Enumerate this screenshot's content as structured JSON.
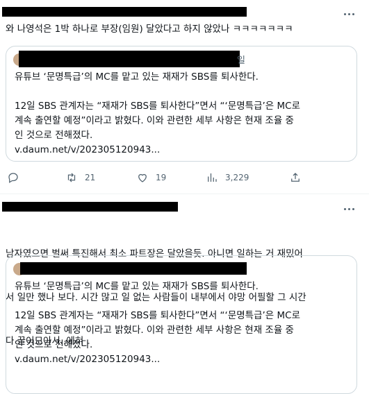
{
  "tweets": [
    {
      "text": "와 나영석은 1박 하나로 부장(임원) 달았다고 하지 않았나 ㅋㅋㅋㅋㅋㅋㅋ",
      "quote": {
        "name_suffix": "일",
        "headline": "유튜브 ‘문명특급’의 MC를 맡고 있는 재재가 SBS를 퇴사한다.",
        "body_lines": [
          "12일 SBS 관계자는 “재재가 SBS를 퇴사한다”면서 “‘문명특급’은 MC로",
          "계속 출연할 예정”이라고 밝혔다. 이와 관련한 세부 사항은 현재 조율 중",
          "인 것으로 전해졌다."
        ],
        "link": "v.daum.net/v/202305120943..."
      },
      "actions": {
        "replies": "",
        "retweets": "21",
        "likes": "19",
        "views": "3,229"
      }
    },
    {
      "text_lines": [
        "남자였으면 벌써 특진해서 최소 파트장은 달았을듯. 아니면 일하는 거 재밌어",
        "서 일만 했나 보다. 시간 많고 일 없는 사람들이 내부에서 야망 어필할 그 시간",
        "다 끌어모아서..에혀"
      ],
      "quote": {
        "headline": "유튜브 ‘문명특급’의 MC를 맡고 있는 재재가 SBS를 퇴사한다.",
        "body_lines": [
          "12일 SBS 관계자는 “재재가 SBS를 퇴사한다”면서 “‘문명특급’은 MC로",
          "계속 출연할 예정”이라고 밝혔다. 이와 관련한 세부 사항은 현재 조율 중",
          "인 것으로 전해졌다."
        ],
        "link": "v.daum.net/v/202305120943..."
      }
    }
  ],
  "colors": {
    "text": "#0f1419",
    "secondary": "#536471",
    "border": "#cfd9de",
    "redaction": "#000000"
  },
  "icons": [
    "more-icon",
    "reply-icon",
    "retweet-icon",
    "like-icon",
    "views-icon",
    "share-icon"
  ]
}
